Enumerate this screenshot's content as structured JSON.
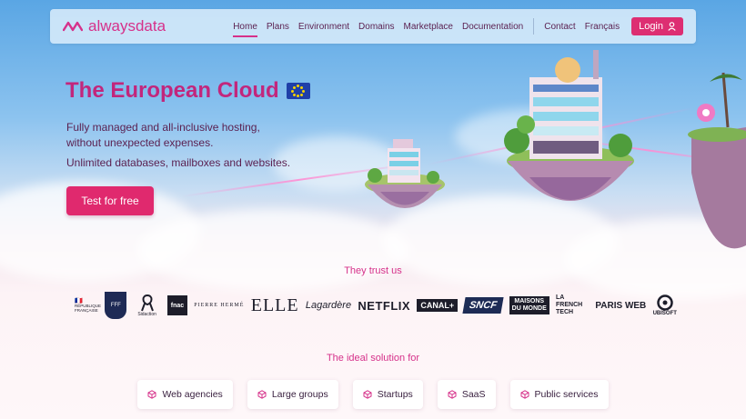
{
  "nav": {
    "brand": "alwaysdata",
    "items": [
      "Home",
      "Plans",
      "Environment",
      "Domains",
      "Marketplace",
      "Documentation"
    ],
    "secondary": [
      "Contact",
      "Français"
    ],
    "login": "Login",
    "active": "Home"
  },
  "hero": {
    "title": "The European Cloud",
    "subtitle": "Fully managed and all-inclusive hosting, without unexpected expenses.",
    "subtitle2": "Unlimited databases, mailboxes and websites.",
    "cta": "Test for free"
  },
  "trust": {
    "title": "They trust us",
    "logos": [
      "RÉPUBLIQUE FRANÇAISE",
      "FFF",
      "Sidaction",
      "fnac",
      "PIERRE HERMÉ",
      "ELLE",
      "Lagardère",
      "NETFLIX",
      "CANAL+",
      "SNCF",
      "MAISONS DU MONDE",
      "LA FRENCH TECH",
      "PARIS WEB",
      "UBISOFT"
    ]
  },
  "ideal": {
    "title": "The ideal solution for",
    "chips": [
      "Web agencies",
      "Large groups",
      "Startups",
      "SaaS",
      "Public services"
    ]
  },
  "colors": {
    "accent": "#d6318a",
    "cta": "#e0296e",
    "text": "#5a1f4f"
  }
}
